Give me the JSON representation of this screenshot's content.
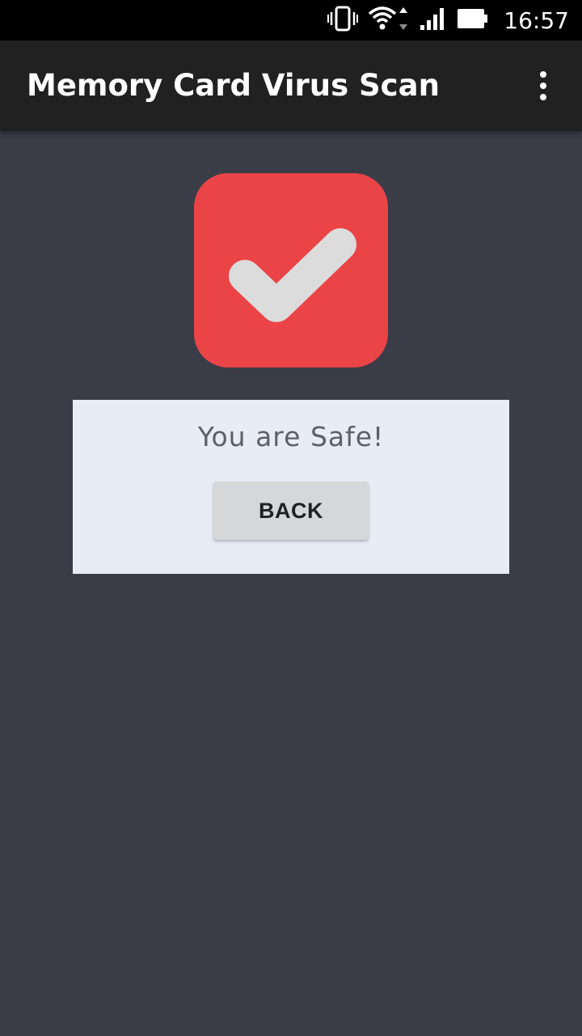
{
  "status_bar": {
    "time": "16:57",
    "icons": [
      "vibrate-icon",
      "wifi-icon",
      "signal-icon",
      "battery-icon"
    ]
  },
  "app_bar": {
    "title": "Memory Card Virus Scan",
    "menu_icon": "overflow-menu-icon"
  },
  "result": {
    "icon": "checkmark-icon",
    "message": "You are Safe!",
    "back_label": "BACK"
  },
  "colors": {
    "background": "#3a3d48",
    "app_bar": "#212121",
    "status_bar": "#000000",
    "check_tile": "#ea4447",
    "checkmark": "#dcdcdc",
    "card": "#e8ecf5",
    "button": "#d6d7d8"
  }
}
